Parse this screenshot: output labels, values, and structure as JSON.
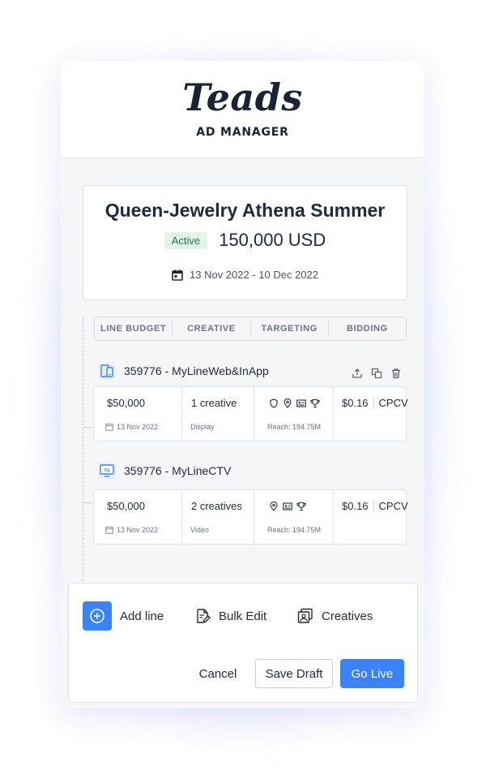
{
  "brand": {
    "logo_text": "Teads",
    "product": "AD MANAGER"
  },
  "campaign": {
    "title": "Queen-Jewelry Athena Summer",
    "status": "Active",
    "budget": "150,000 USD",
    "date_range": "13 Nov 2022 - 10 Dec 2022"
  },
  "tabs": [
    "LINE BUDGET",
    "CREATIVE",
    "TARGETING",
    "BIDDING"
  ],
  "lines": [
    {
      "name": "359776 - MyLineWeb&InApp",
      "icon": "web-inapp-device-icon",
      "budget": "$50,000",
      "start_date": "13 Nov 2022",
      "creative_count": "1 creative",
      "creative_format": "Display",
      "targeting_icons": [
        "shield-icon",
        "location-pin-icon",
        "profile-card-icon",
        "trophy-icon"
      ],
      "reach": "Reach: 194.75M",
      "bid_value": "$0.16",
      "bid_type": "CPCV"
    },
    {
      "name": "359776 - MyLineCTV",
      "icon": "tv-icon",
      "budget": "$50,000",
      "start_date": "13 Nov 2022",
      "creative_count": "2 creatives",
      "creative_format": "Video",
      "targeting_icons": [
        "location-pin-icon",
        "profile-card-icon",
        "trophy-icon"
      ],
      "reach": "Reach: 194.75M",
      "bid_value": "$0.16",
      "bid_type": "CPCV"
    }
  ],
  "footer": {
    "add_line": "Add line",
    "bulk_edit": "Bulk Edit",
    "creatives": "Creatives",
    "cancel": "Cancel",
    "save_draft": "Save Draft",
    "go_live": "Go Live"
  },
  "colors": {
    "primary": "#3b82f6",
    "active_badge_bg": "#e2f4e8",
    "active_badge_text": "#1f7a3f",
    "text_dark": "#1f2a3a"
  }
}
